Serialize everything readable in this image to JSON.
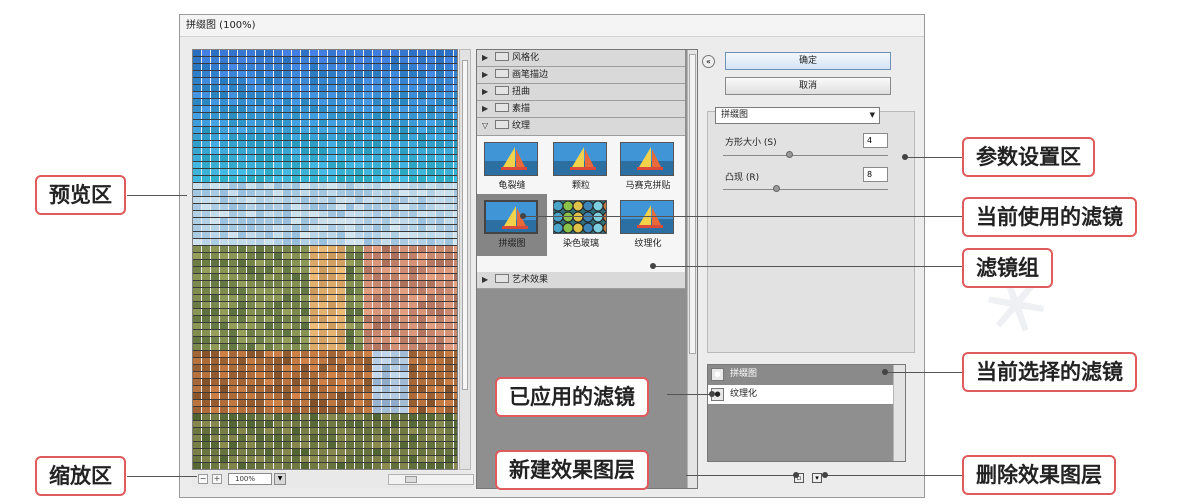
{
  "dialog": {
    "title": "拼缀图 (100%)",
    "zoom": "100%",
    "zoom_minus": "−",
    "zoom_plus": "+"
  },
  "gallery": {
    "categories_top": [
      {
        "label": "风格化",
        "expanded": false
      },
      {
        "label": "画笔描边",
        "expanded": false
      },
      {
        "label": "扭曲",
        "expanded": false
      },
      {
        "label": "素描",
        "expanded": false
      },
      {
        "label": "纹理",
        "expanded": true
      }
    ],
    "texture_filters": [
      {
        "label": "龟裂缝"
      },
      {
        "label": "颗粒"
      },
      {
        "label": "马赛克拼贴"
      },
      {
        "label": "拼缀图",
        "selected": true
      },
      {
        "label": "染色玻璃"
      },
      {
        "label": "纹理化"
      }
    ],
    "categories_bottom": [
      {
        "label": "艺术效果",
        "expanded": false
      }
    ]
  },
  "buttons": {
    "ok": "确定",
    "cancel": "取消"
  },
  "params": {
    "filter_select": "拼缀图",
    "square_size_label": "方形大小 (S)",
    "square_size_value": "4",
    "square_size_fraction": 0.4,
    "relief_label": "凸现 (R)",
    "relief_value": "8",
    "relief_fraction": 0.32
  },
  "layers": {
    "items": [
      {
        "label": "拼缀图",
        "selected": true
      },
      {
        "label": "纹理化",
        "selected": false
      }
    ]
  },
  "callouts": {
    "preview": "预览区",
    "zoom": "缩放区",
    "params": "参数设置区",
    "current_filter": "当前使用的滤镜",
    "filter_group": "滤镜组",
    "current_selected": "当前选择的滤镜",
    "applied": "已应用的滤镜",
    "new_layer": "新建效果图层",
    "delete_layer": "删除效果图层"
  }
}
